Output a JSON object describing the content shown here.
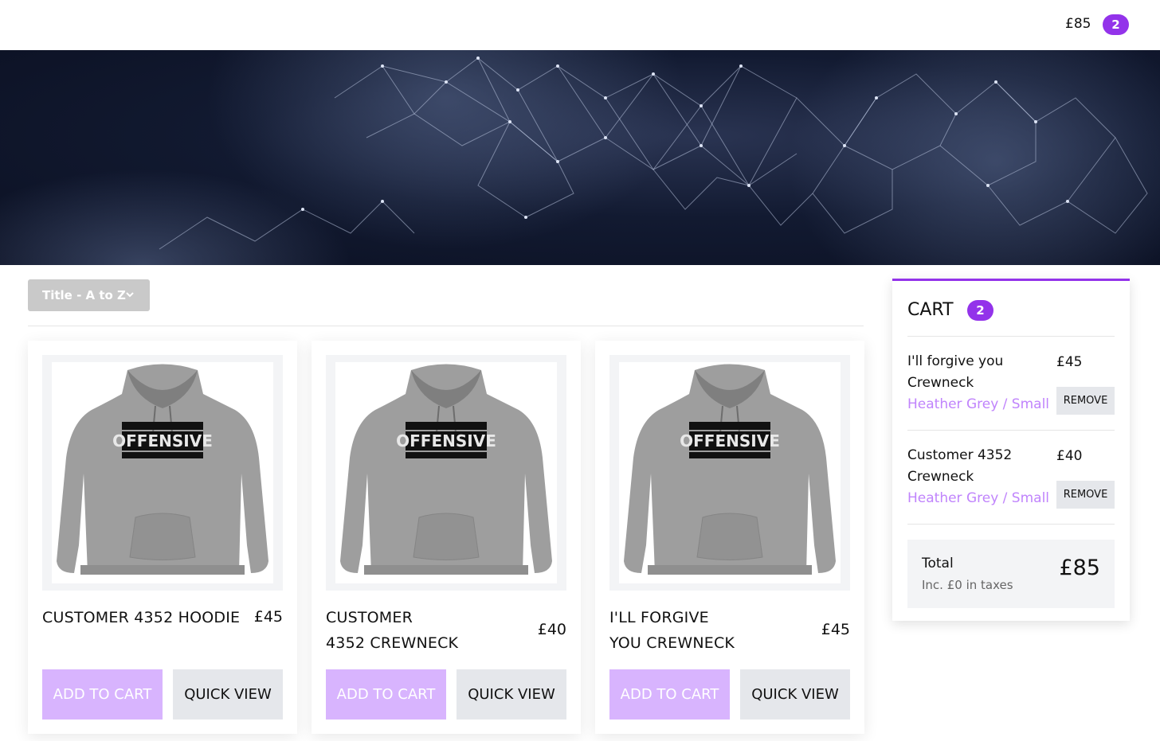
{
  "header": {
    "cart_total": "£85",
    "cart_count": "2"
  },
  "sort": {
    "label": "Title - A to Z"
  },
  "products": [
    {
      "name": "CUSTOMER 4352 HOODIE",
      "price": "£45",
      "add_label": "ADD TO CART",
      "quick_view_label": "QUICK VIEW",
      "image": "grey-hoodie-offensive-print"
    },
    {
      "name_line1": "CUSTOMER",
      "name_line2": "4352 CREWNECK",
      "price": "£40",
      "add_label": "ADD TO CART",
      "quick_view_label": "QUICK VIEW",
      "image": "grey-hoodie-offensive-print"
    },
    {
      "name_line1": "I'LL FORGIVE",
      "name_line2": "YOU CREWNECK",
      "price": "£45",
      "add_label": "ADD TO CART",
      "quick_view_label": "QUICK VIEW",
      "image": "grey-hoodie-offensive-print"
    }
  ],
  "cart": {
    "title": "CART",
    "count": "2",
    "items": [
      {
        "name_line1": "I'll forgive you",
        "name_line2": "Crewneck",
        "variant": "Heather Grey / Small",
        "price": "£45",
        "remove_label": "REMOVE"
      },
      {
        "name_line1": "Customer 4352",
        "name_line2": "Crewneck",
        "variant": "Heather Grey / Small",
        "price": "£40",
        "remove_label": "REMOVE"
      }
    ],
    "total_label": "Total",
    "tax_note": "Inc. £0 in taxes",
    "total_value": "£85"
  },
  "colors": {
    "accent": "#9333ea",
    "add_button": "#d8b4fe",
    "variant_text": "#c084fc",
    "hero_bg": "#121a31"
  }
}
